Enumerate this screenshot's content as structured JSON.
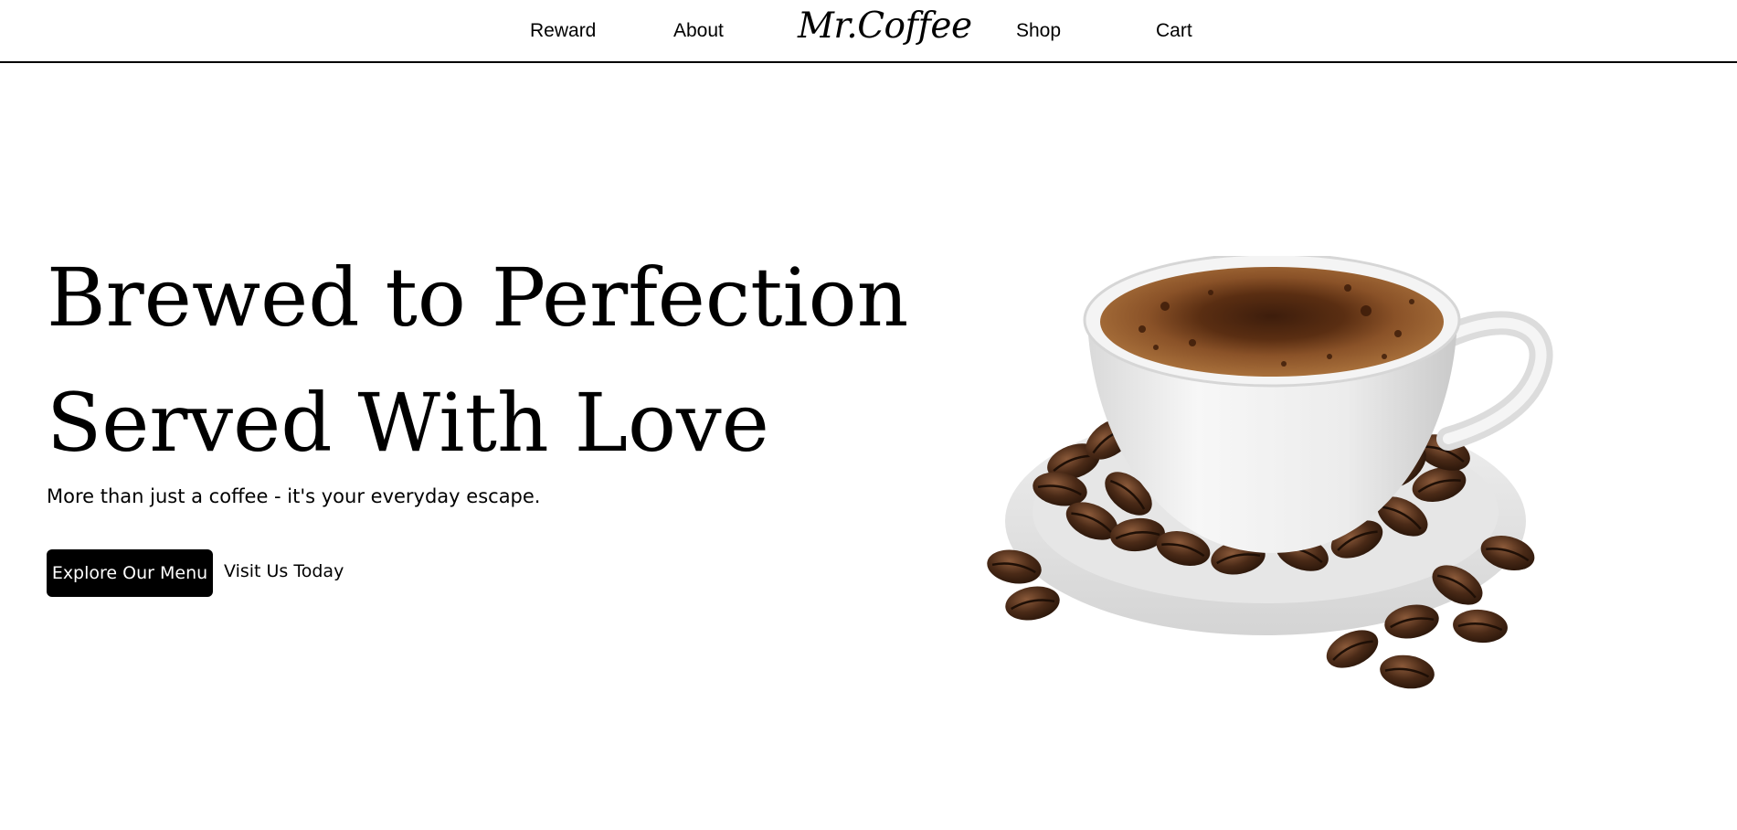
{
  "nav": {
    "reward_label": "Reward",
    "about_label": "About",
    "logo_text": "Mr.Coffee",
    "shop_label": "Shop",
    "cart_label": "Cart"
  },
  "hero": {
    "title_line_1": "Brewed to Perfection",
    "title_line_2": "Served With Love",
    "tagline": "More than just a coffee - it's your everyday escape.",
    "primary_button_label": "Explore Our Menu",
    "secondary_button_label": "Visit Us Today",
    "image_alt": "coffee-cup-with-beans"
  },
  "colors": {
    "background": "#ffffff",
    "text": "#000000",
    "button_bg": "#000000",
    "button_text": "#ffffff",
    "coffee_crema": "#8a5228",
    "coffee_bean": "#4a2a17",
    "porcelain": "#f2f2f2"
  }
}
